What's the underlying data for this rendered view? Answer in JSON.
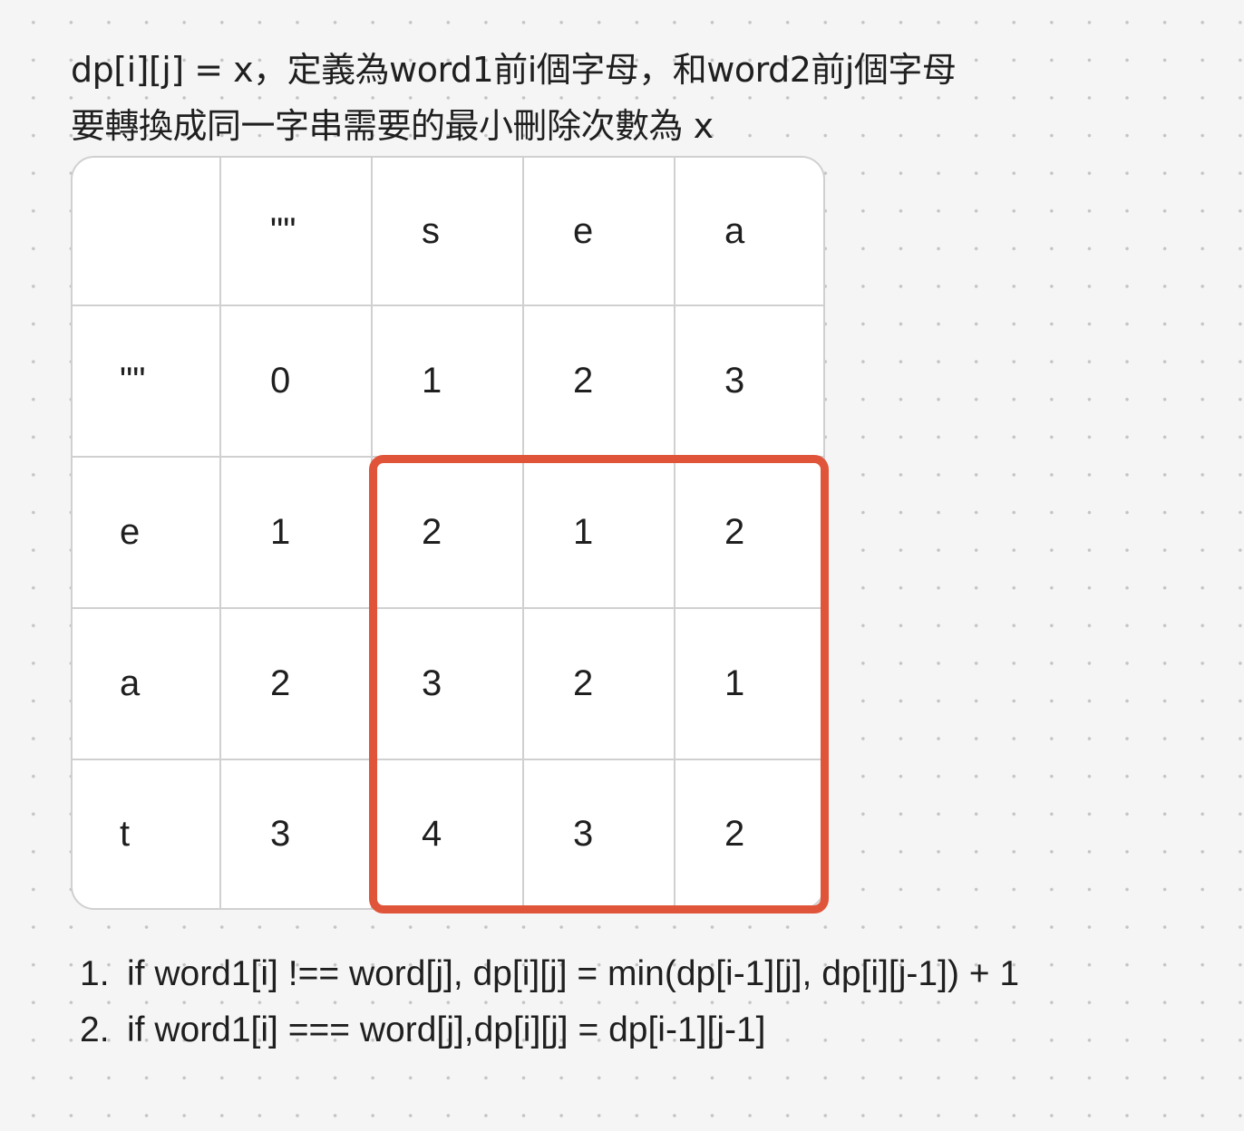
{
  "description": {
    "line1": "dp[i][j] = x，定義為word1前i個字母，和word2前j個字母",
    "line2": "要轉換成同一字串需要的最小刪除次數為 x"
  },
  "table": {
    "corner": "",
    "column_headers": [
      "\"\"",
      "s",
      "e",
      "a"
    ],
    "rows": [
      {
        "label": "\"\"",
        "values": [
          "0",
          "1",
          "2",
          "3"
        ]
      },
      {
        "label": "e",
        "values": [
          "1",
          "2",
          "1",
          "2"
        ]
      },
      {
        "label": "a",
        "values": [
          "2",
          "3",
          "2",
          "1"
        ]
      },
      {
        "label": "t",
        "values": [
          "3",
          "4",
          "3",
          "2"
        ]
      }
    ],
    "highlight_color": "#e0553a"
  },
  "rules": [
    {
      "number": "1.",
      "text": "if word1[i] !== word[j], dp[i][j] = min(dp[i-1][j], dp[i][j-1]) + 1"
    },
    {
      "number": "2.",
      "text": "if word1[i] === word[j],dp[i][j] = dp[i-1][j-1]"
    }
  ]
}
